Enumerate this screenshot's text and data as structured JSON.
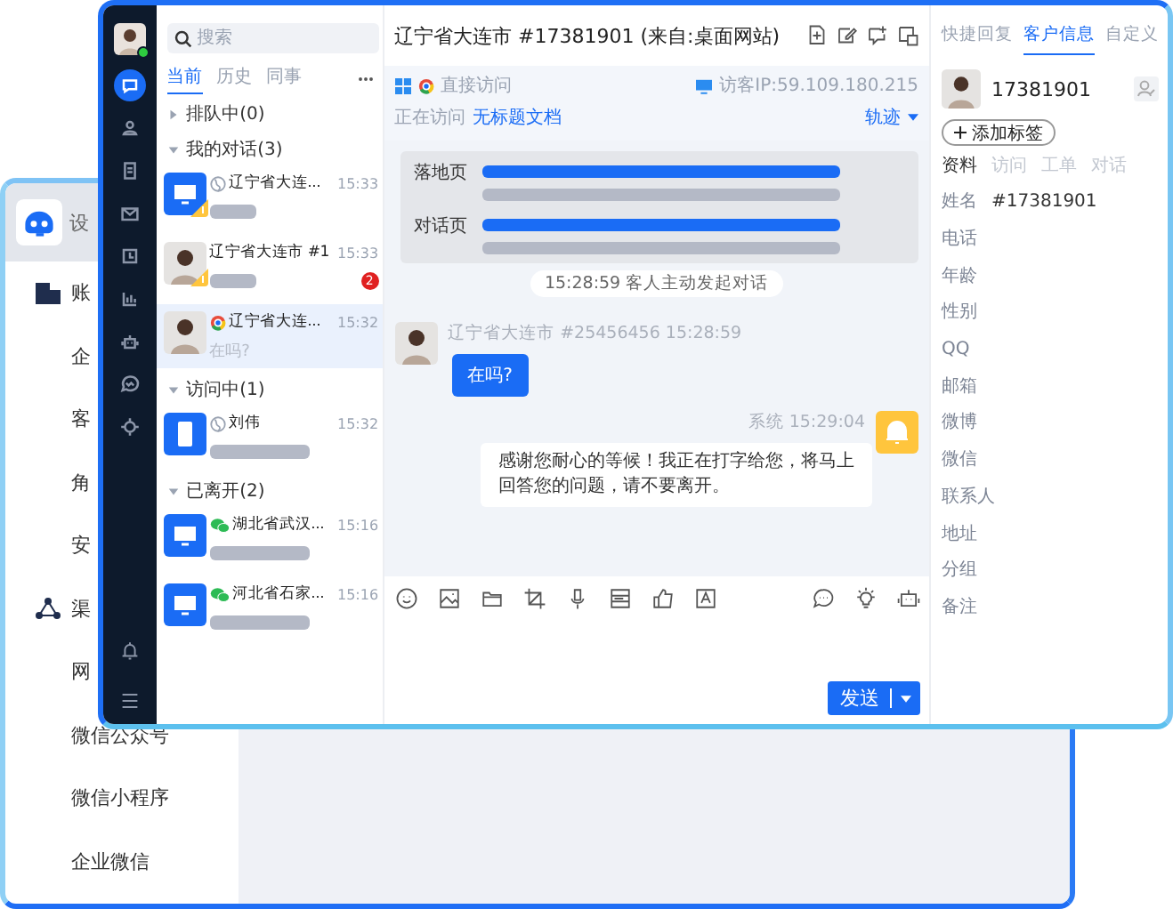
{
  "back_window": {
    "title": "设",
    "nav": [
      {
        "label": "账",
        "kind": "section"
      },
      {
        "label": "企",
        "kind": "item"
      },
      {
        "label": "客",
        "kind": "item"
      },
      {
        "label": "角",
        "kind": "item"
      },
      {
        "label": "安",
        "kind": "item"
      },
      {
        "label": "渠",
        "kind": "section"
      },
      {
        "label": "网",
        "kind": "item"
      },
      {
        "label": "微信公众号",
        "kind": "item"
      },
      {
        "label": "微信小程序",
        "kind": "item"
      },
      {
        "label": "企业微信",
        "kind": "item"
      }
    ]
  },
  "front_window": {
    "sidebar": {
      "online": true,
      "items": [
        {
          "selected": true
        },
        {
          "selected": false
        },
        {
          "selected": false
        },
        {
          "selected": false
        },
        {
          "selected": false
        },
        {
          "selected": false
        },
        {
          "selected": false
        },
        {
          "selected": false
        },
        {
          "selected": false
        }
      ]
    },
    "search": {
      "placeholder": "搜索"
    },
    "tabs": [
      {
        "label": "当前",
        "selected": true
      },
      {
        "label": "历史",
        "selected": false
      },
      {
        "label": "同事",
        "selected": false
      }
    ],
    "groups": [
      {
        "label": "排队中(0)",
        "expanded": false
      },
      {
        "label": "我的对话(3)",
        "expanded": true,
        "items": [
          {
            "kind": "desktop",
            "source": {
              "kind": "web"
            },
            "name": "辽宁省大连...",
            "time": "15:33",
            "pending": true,
            "selected": false
          },
          {
            "kind": "photo",
            "name": "辽宁省大连市 #1",
            "time": "15:33",
            "pending": true,
            "badge": "2",
            "selected": false
          },
          {
            "kind": "photo",
            "source": {
              "kind": "chrome"
            },
            "name": "辽宁省大连...",
            "time": "15:32",
            "preview": "在吗?",
            "pending": false,
            "selected": true
          }
        ]
      },
      {
        "label": "访问中(1)",
        "expanded": true,
        "items": [
          {
            "kind": "mobile",
            "source": {
              "kind": "web"
            },
            "name": "刘伟",
            "time": "15:32",
            "pending": false,
            "selected": false
          }
        ]
      },
      {
        "label": "已离开(2)",
        "expanded": true,
        "items": [
          {
            "kind": "desktop",
            "source": {
              "kind": "wechat"
            },
            "name": "湖北省武汉...",
            "time": "15:16",
            "pending": false,
            "selected": false
          },
          {
            "kind": "desktop",
            "source": {
              "kind": "wechat"
            },
            "name": "河北省石家...",
            "time": "15:16",
            "pending": false,
            "selected": false
          }
        ]
      }
    ],
    "chat": {
      "title": "辽宁省大连市 #17381901 (来自:桌面网站)",
      "visit": {
        "entry": "直接访问",
        "ip": "访客IP:59.109.180.215",
        "status": "正在访问",
        "page": "无标题文档",
        "trail": "轨迹"
      },
      "pages": [
        {
          "label": "落地页"
        },
        {
          "label": "对话页"
        }
      ],
      "messages": [
        {
          "kind": "notice",
          "text": "15:28:59 客人主动发起对话"
        },
        {
          "kind": "customer",
          "meta": "辽宁省大连市 #25456456 15:28:59",
          "text": "在吗?"
        },
        {
          "kind": "system",
          "meta": "系统 15:29:04",
          "text": "感谢您耐心的等候！我正在打字给您，将马上回答您的问题，请不要离开。"
        }
      ],
      "send": "发送"
    },
    "info": {
      "tabs": [
        {
          "label": "快捷回复",
          "selected": false
        },
        {
          "label": "客户信息",
          "selected": true
        },
        {
          "label": "自定义",
          "selected": false
        }
      ],
      "customer_id": "17381901",
      "add_tag": "添加标签",
      "subtabs": [
        {
          "label": "资料",
          "selected": true
        },
        {
          "label": "访问",
          "selected": false
        },
        {
          "label": "工单",
          "selected": false
        },
        {
          "label": "对话",
          "selected": false
        }
      ],
      "fields": [
        {
          "label": "姓名",
          "value": "#17381901"
        },
        {
          "label": "电话"
        },
        {
          "label": "年龄"
        },
        {
          "label": "性别"
        },
        {
          "label": "QQ"
        },
        {
          "label": "邮箱"
        },
        {
          "label": "微博"
        },
        {
          "label": "微信"
        },
        {
          "label": "联系人"
        },
        {
          "label": "地址"
        },
        {
          "label": "分组"
        },
        {
          "label": "备注"
        }
      ]
    }
  }
}
